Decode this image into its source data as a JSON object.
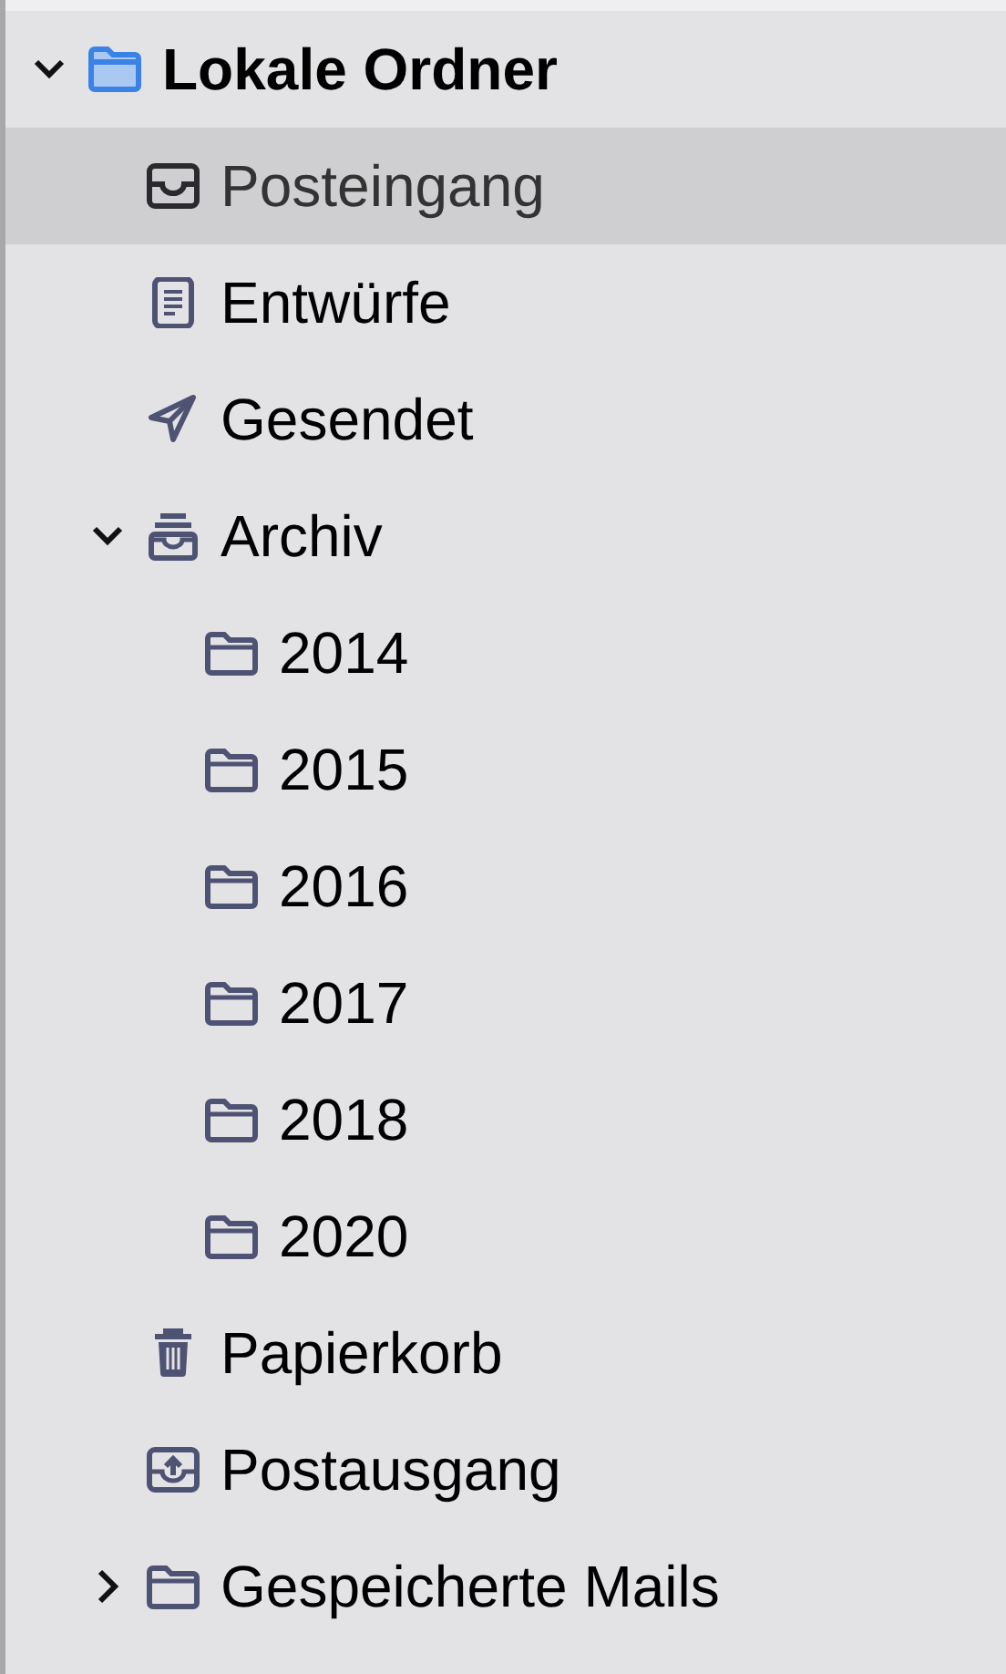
{
  "folders": [
    {
      "label": "Lokale Ordner",
      "kind": "account",
      "selected": false,
      "expanded": true,
      "children": [
        {
          "label": "Posteingang",
          "kind": "inbox",
          "selected": true
        },
        {
          "label": "Entwürfe",
          "kind": "drafts",
          "selected": false
        },
        {
          "label": "Gesendet",
          "kind": "sent",
          "selected": false
        },
        {
          "label": "Archiv",
          "kind": "archive",
          "selected": false,
          "expanded": true,
          "children": [
            {
              "label": "2014",
              "kind": "folder",
              "selected": false
            },
            {
              "label": "2015",
              "kind": "folder",
              "selected": false
            },
            {
              "label": "2016",
              "kind": "folder",
              "selected": false
            },
            {
              "label": "2017",
              "kind": "folder",
              "selected": false
            },
            {
              "label": "2018",
              "kind": "folder",
              "selected": false
            },
            {
              "label": "2020",
              "kind": "folder",
              "selected": false
            }
          ]
        },
        {
          "label": "Papierkorb",
          "kind": "trash",
          "selected": false
        },
        {
          "label": "Postausgang",
          "kind": "outbox",
          "selected": false
        },
        {
          "label": "Gespeicherte Mails",
          "kind": "folder",
          "selected": false,
          "expanded": false
        }
      ]
    }
  ]
}
